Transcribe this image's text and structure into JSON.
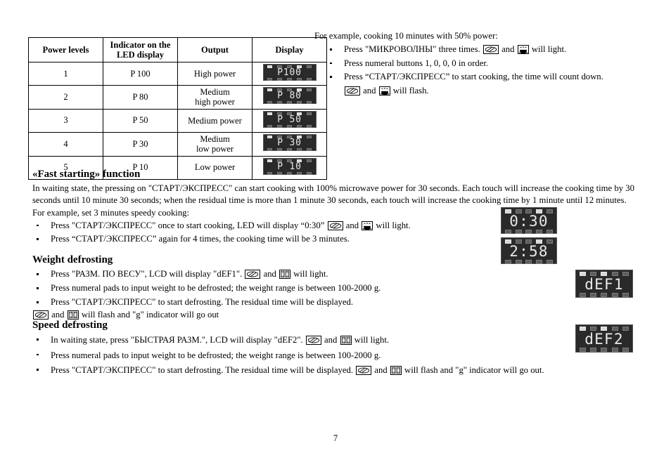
{
  "page": {
    "number": "7"
  },
  "power_table": {
    "headers": [
      "Power levels",
      "Indicator on the LED display",
      "Output",
      "Display"
    ],
    "header_line1": [
      "Power levels",
      "Indicator on the",
      "Output",
      "Display"
    ],
    "header_line2": [
      "",
      "LED display",
      "",
      ""
    ],
    "rows": [
      {
        "level": "1",
        "indicator": "P 100",
        "output": "High power",
        "output_l1": "High power",
        "output_l2": "",
        "display": "P100"
      },
      {
        "level": "2",
        "indicator": "P 80",
        "output": "Medium high power",
        "output_l1": "Medium",
        "output_l2": "high power",
        "display": "P 80"
      },
      {
        "level": "3",
        "indicator": "P 50",
        "output": "Medium power",
        "output_l1": "Medium power",
        "output_l2": "",
        "display": "P 50"
      },
      {
        "level": "4",
        "indicator": "P 30",
        "output": "Medium low power",
        "output_l1": "Medium",
        "output_l2": "low power",
        "display": "P 30"
      },
      {
        "level": "5",
        "indicator": "P 10",
        "output": "Low power",
        "output_l1": "Low power",
        "output_l2": "",
        "display": "P 10"
      }
    ]
  },
  "example_block": {
    "lead": "For example, cooking 10 minutes with 50% power:",
    "b1_a": "Press \"МИКРОВОЛНЫ\" three times.",
    "b1_and": "and",
    "b1_b": "will light.",
    "b2": "Press numeral buttons 1, 0, 0, 0 in order.",
    "b3": "Press “СТАРТ/ЭКСПРЕСС” to start cooking, the time will count down.",
    "b3_cont_and": "and",
    "b3_cont_tail": "will flash."
  },
  "fast_starting": {
    "title": "«Fast starting» function",
    "body": "In waiting state, the pressing on \"СТАРТ/ЭКСПРЕСС\" can start cooking with 100% microwave power for 30 seconds. Each touch will increase the cooking time by 30 seconds until 10 minute 30 seconds; when the residual time is more than 1 minute 30 seconds, each touch will increase the cooking time by 1 minute until 12 minutes.",
    "example_lead": "For example, set 3 minutes speedy cooking:",
    "b1_a": "Press \"СТАРТ/ЭКСПРЕСС\" once to start cooking, LED will display “0:30”",
    "b1_and": "and",
    "b1_b": "will light.",
    "b2": "Press “СТАРТ/ЭКСПРЕСС” again for 4 times, the cooking time will be 3 minutes.",
    "display_1": "0:30",
    "display_2": "2:58"
  },
  "weight_defrosting": {
    "title": "Weight defrosting",
    "b1_a": "Press \"РАЗМ. ПО ВЕСУ\", LCD will display \"dEF1\".",
    "b1_and": "and",
    "b1_b": "will light.",
    "b2": "Press numeral pads to input weight to be defrosted; the weight range is between 100-2000 g.",
    "b3": "Press \"СТАРТ/ЭКСПРЕСС\" to start defrosting. The residual time will be displayed.",
    "tail_and": "and",
    "tail_text": "will flash and \"g\" indicator will go out",
    "display": "dEF1"
  },
  "speed_defrosting": {
    "title": "Speed defrosting",
    "b1_a": "In waiting state, press \"БЫСТРАЯ РАЗМ.\", LCD will display \"dEF2\".",
    "b1_and": "and",
    "b1_b": "will light.",
    "b2": "Press numeral pads to input weight to be defrosted; the weight range is between 100-2000 g.",
    "b3_a": "Press \"СТАРТ/ЭКСПРЕСС\" to start defrosting. The residual time will be displayed.",
    "b3_and": "and",
    "b3_b": "will flash and \"g\" indicator will go out.",
    "display": "dEF2"
  },
  "colors": {
    "led_background": "#2a2a2a",
    "led_digit": "#e9e9e9",
    "led_indicator_off": "#5d5d5d",
    "led_indicator_on": "#d8d8d8",
    "page_background": "#ffffff",
    "text": "#000000"
  },
  "icons": {
    "microwave": "microwave-icon",
    "cup": "heating-cup-icon",
    "snowflake": "defrost-snowflake-icon"
  }
}
